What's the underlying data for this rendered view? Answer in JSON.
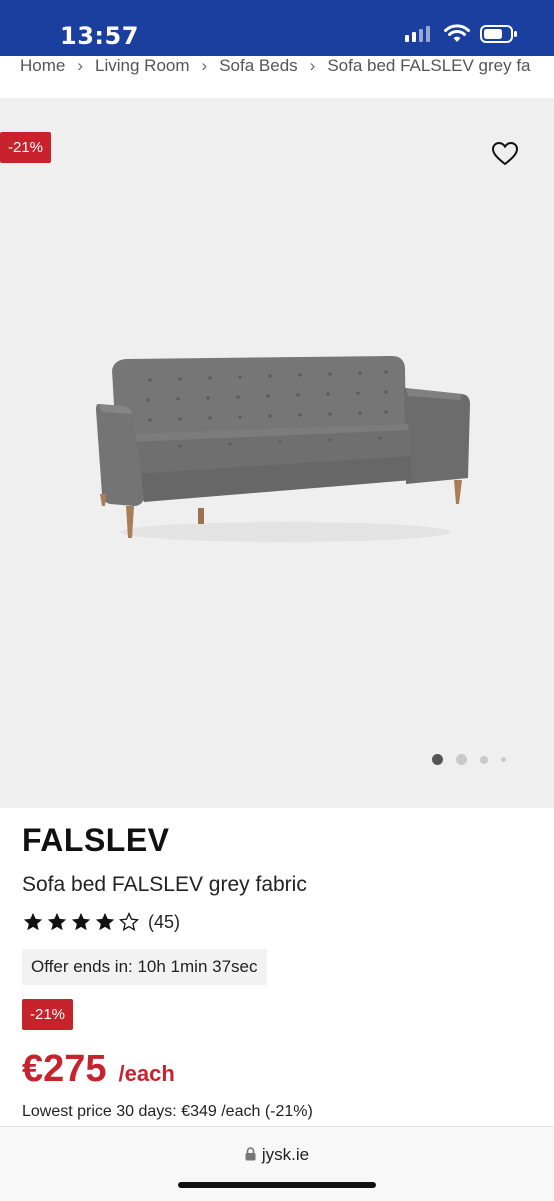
{
  "status_bar": {
    "time": "13:57"
  },
  "breadcrumb": {
    "items": [
      "Home",
      "Living Room",
      "Sofa Beds",
      "Sofa bed FALSLEV grey fa"
    ]
  },
  "gallery": {
    "discount_badge": "-21%",
    "image_alt": "Sofa bed FALSLEV grey fabric",
    "dot_count": 4,
    "active_dot": 0
  },
  "product": {
    "brand": "FALSLEV",
    "name": "Sofa bed FALSLEV grey fabric",
    "rating": 4,
    "rating_max": 5,
    "review_count": "(45)",
    "offer_text": "Offer ends in: 10h 1min 37sec",
    "discount_badge": "-21%",
    "price": "€275",
    "unit": "/each",
    "lowest_price": "Lowest price 30 days: €349 /each (-21%)"
  },
  "browser": {
    "url": "jysk.ie"
  },
  "colors": {
    "header_blue": "#1a3f9e",
    "sale_red": "#c8232c"
  }
}
